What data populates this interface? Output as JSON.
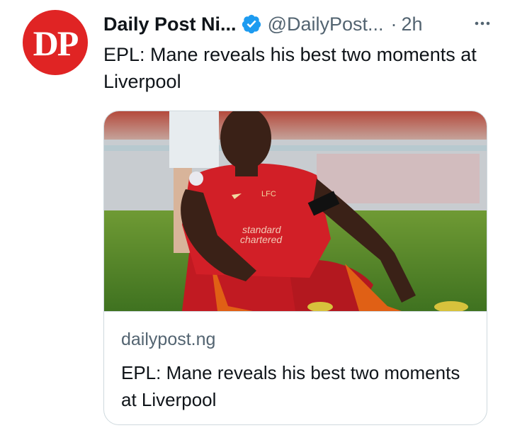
{
  "avatar": {
    "text": "DP",
    "color": "#e02424"
  },
  "tweet": {
    "author_name": "Daily Post Ni...",
    "handle": "@DailyPost...",
    "separator": "·",
    "time": "2h",
    "text": "EPL: Mane reveals his best two moments at Liverpool",
    "verified_icon": "verified-badge-icon",
    "more_icon": "more-dots-icon"
  },
  "card": {
    "domain": "dailypost.ng",
    "title": "EPL: Mane reveals his best two moments at Liverpool",
    "image_kit": {
      "crest": "LFC",
      "sponsor_line1": "standard",
      "sponsor_line2": "chartered"
    }
  },
  "colors": {
    "accent": "#1d9bf0",
    "text": "#0f1419",
    "muted": "#536471",
    "border": "#cfd9de",
    "kit_red": "#d21f27"
  }
}
